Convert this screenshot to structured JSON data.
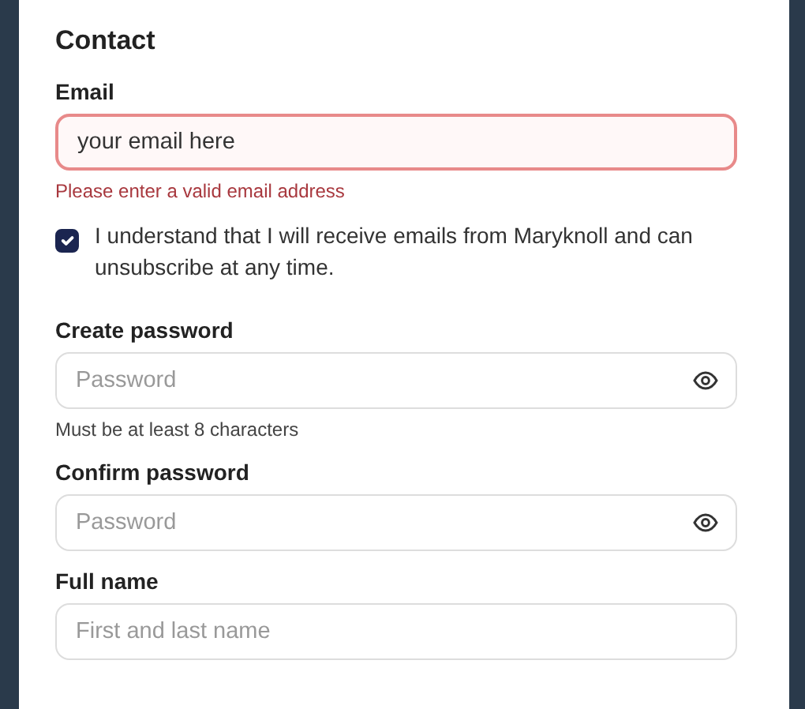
{
  "section": {
    "title": "Contact"
  },
  "fields": [
    {
      "kind": "text",
      "label": "Email",
      "value": "your email here",
      "invalid": true,
      "error": "Please enter a valid email address"
    },
    {
      "kind": "checkbox",
      "label": "I understand that I will receive emails from Maryknoll and can unsubscribe at any time.",
      "checked": true
    },
    {
      "kind": "password",
      "label": "Create password",
      "placeholder": "Password",
      "hint": "Must be at least 8 characters"
    },
    {
      "kind": "password",
      "label": "Confirm password",
      "placeholder": "Password"
    },
    {
      "kind": "text",
      "label": "Full name",
      "placeholder": "First and last name",
      "invalid": false
    }
  ]
}
